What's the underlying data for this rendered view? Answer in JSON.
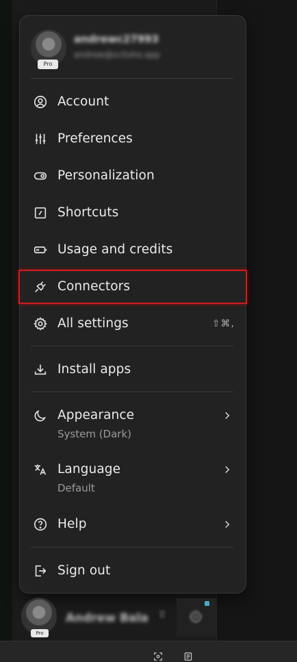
{
  "profile": {
    "username": "andrewc27993",
    "email": "andrew@scitoho.app",
    "badge": "Pro"
  },
  "menu": {
    "items": [
      {
        "key": "account",
        "label": "Account",
        "icon": "user-circle-icon"
      },
      {
        "key": "preferences",
        "label": "Preferences",
        "icon": "sliders-icon"
      },
      {
        "key": "personalization",
        "label": "Personalization",
        "icon": "toggle-icon"
      },
      {
        "key": "shortcuts",
        "label": "Shortcuts",
        "icon": "shortcut-square-icon"
      },
      {
        "key": "usage",
        "label": "Usage and credits",
        "icon": "battery-icon"
      },
      {
        "key": "connectors",
        "label": "Connectors",
        "icon": "plug-icon",
        "highlighted": true
      },
      {
        "key": "all_settings",
        "label": "All settings",
        "icon": "gear-icon",
        "shortcut": "⇧⌘,"
      },
      {
        "key": "install_apps",
        "label": "Install apps",
        "icon": "download-icon"
      },
      {
        "key": "appearance",
        "label": "Appearance",
        "sublabel": "System (Dark)",
        "icon": "moon-icon",
        "submenu": true
      },
      {
        "key": "language",
        "label": "Language",
        "sublabel": "Default",
        "icon": "translate-icon",
        "submenu": true
      },
      {
        "key": "help",
        "label": "Help",
        "icon": "help-circle-icon",
        "submenu": true
      },
      {
        "key": "sign_out",
        "label": "Sign out",
        "icon": "sign-out-icon"
      }
    ]
  },
  "footer": {
    "name": "Andrew Bala",
    "badge": "Pro",
    "dots": "⠿"
  },
  "colors": {
    "menu_bg": "#222222",
    "highlight_border": "#d01c1f",
    "notification_dot": "#4aa8c8"
  }
}
